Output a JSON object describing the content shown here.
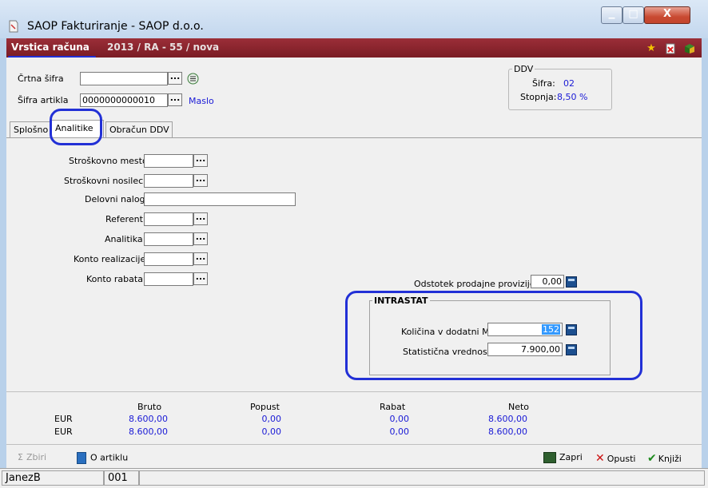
{
  "window": {
    "title": "SAOP Fakturiranje - SAOP d.o.o.",
    "controls": {
      "minimize": "▁",
      "maximize": "□",
      "close": "X"
    }
  },
  "header": {
    "record_type": "Vrstica računa",
    "record_id": "2013 / RA - 55 / nova"
  },
  "top_fields": {
    "crtna_sifra": {
      "label": "Črtna šifra",
      "value": ""
    },
    "sifra_artikla": {
      "label": "Šifra artikla",
      "value": "0000000000010",
      "article_name": "Maslo"
    }
  },
  "ddv": {
    "title": "DDV",
    "sifra_label": "Šifra:",
    "sifra_value": "02",
    "stopnja_label": "Stopnja:",
    "stopnja_value": "8,50 %"
  },
  "tabs": [
    {
      "label": "Splošno"
    },
    {
      "label": "Analitike"
    },
    {
      "label": "Obračun DDV"
    }
  ],
  "analitike": {
    "stroskovno_mesto": {
      "label": "Stroškovno mesto",
      "value": ""
    },
    "stroskovni_nosilec": {
      "label": "Stroškovni  nosilec",
      "value": ""
    },
    "delovni_nalog": {
      "label": "Delovni nalog",
      "value": ""
    },
    "referent": {
      "label": "Referent",
      "value": ""
    },
    "analitika": {
      "label": "Analitika",
      "value": ""
    },
    "konto_realizacije": {
      "label": "Konto realizacije",
      "value": ""
    },
    "konto_rabata": {
      "label": "Konto rabata",
      "value": ""
    },
    "odstotek_provizije": {
      "label": "Odstotek prodajne provizije",
      "value": "0,00"
    }
  },
  "intrastat": {
    "title": "INTRASTAT",
    "kolicina": {
      "label": "Količina v dodatni ME",
      "value": "152"
    },
    "vrednost": {
      "label": "Statistična vrednost",
      "value": "7.900,00"
    }
  },
  "summary": {
    "headers": {
      "bruto": "Bruto",
      "popust": "Popust",
      "rabat": "Rabat",
      "neto": "Neto"
    },
    "rows": [
      {
        "currency": "EUR",
        "bruto": "8.600,00",
        "popust": "0,00",
        "rabat": "0,00",
        "neto": "8.600,00"
      },
      {
        "currency": "EUR",
        "bruto": "8.600,00",
        "popust": "0,00",
        "rabat": "0,00",
        "neto": "8.600,00"
      }
    ]
  },
  "buttons": {
    "zbiri": "Zbiri",
    "o_artiklu": "O artiklu",
    "zapri": "Zapri",
    "opusti": "Opusti",
    "knjizi": "Knjiži"
  },
  "status": {
    "user": "JanezB",
    "code": "001"
  },
  "colors": {
    "header_bar": "#8b2530",
    "value_blue": "#1a1ad6",
    "annotation": "#2230d6"
  }
}
